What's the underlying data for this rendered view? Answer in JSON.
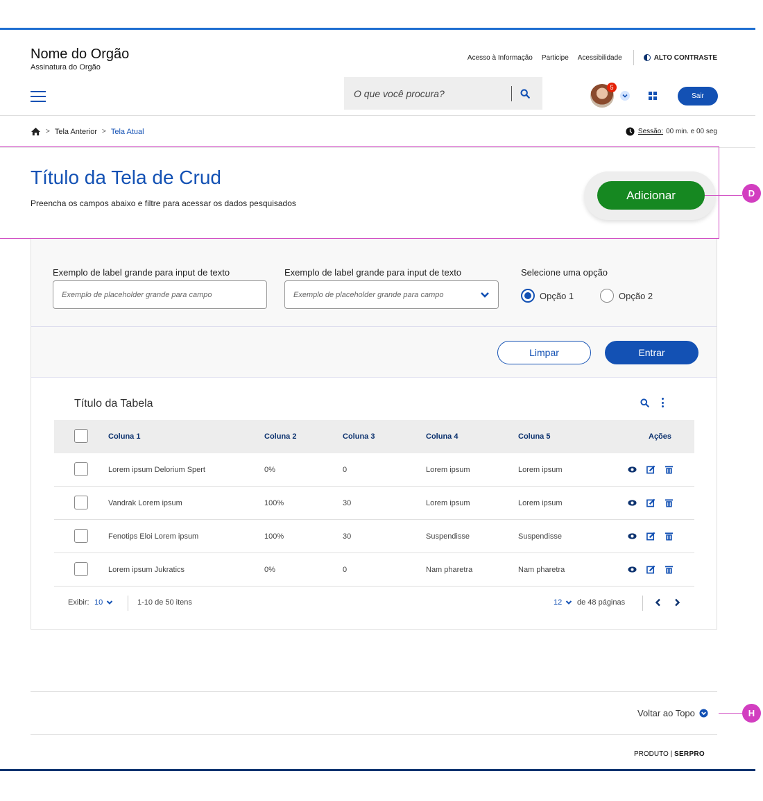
{
  "header": {
    "org_name": "Nome do Orgão",
    "org_subtitle": "Assinatura do Orgão",
    "links": [
      "Acesso à Informação",
      "Participe",
      "Acessibilidade"
    ],
    "contrast_label": "ALTO CONTRASTE",
    "search_placeholder": "O que você procura?",
    "notification_count": "5",
    "logout_label": "Sair"
  },
  "breadcrumb": {
    "previous": "Tela Anterior",
    "current": "Tela Atual"
  },
  "session": {
    "label": "Sessão:",
    "value": "00 min. e 00 seg"
  },
  "page": {
    "title": "Título da Tela de Crud",
    "subtitle": "Preencha os campos abaixo e filtre para acessar os dados pesquisados",
    "add_label": "Adicionar"
  },
  "annotations": {
    "marker_d": "D",
    "marker_h": "H"
  },
  "filters": {
    "text_label": "Exemplo de label grande para input de texto",
    "text_placeholder": "Exemplo de placeholder grande para campo",
    "select_label": "Exemplo de label grande para input de texto",
    "select_placeholder": "Exemplo de placeholder grande para campo",
    "radio_label": "Selecione uma opção",
    "radio_options": [
      "Opção 1",
      "Opção 2"
    ],
    "radio_selected": "Opção 1",
    "clear_label": "Limpar",
    "submit_label": "Entrar"
  },
  "table": {
    "title": "Título da Tabela",
    "columns": [
      "Coluna 1",
      "Coluna 2",
      "Coluna 3",
      "Coluna 4",
      "Coluna 5",
      "Ações"
    ],
    "rows": [
      [
        "Lorem ipsum Delorium Spert",
        "0%",
        "0",
        "Lorem ipsum",
        "Lorem ipsum"
      ],
      [
        "Vandrak Lorem ipsum",
        "100%",
        "30",
        "Lorem ipsum",
        "Lorem ipsum"
      ],
      [
        "Fenotips Eloi Lorem ipsum",
        "100%",
        "30",
        "Suspendisse",
        "Suspendisse"
      ],
      [
        "Lorem ipsum Jukratics",
        "0%",
        "0",
        "Nam pharetra",
        "Nam pharetra"
      ]
    ],
    "pagination": {
      "show_label": "Exibir:",
      "show_value": "10",
      "range_text": "1-10 de 50 itens",
      "current_page": "12",
      "pages_text": "de 48 páginas"
    }
  },
  "footer": {
    "back_to_top": "Voltar ao Topo",
    "brand_prefix": "PRODUTO |",
    "brand_name": "SERPRO"
  },
  "colors": {
    "primary": "#1351b4",
    "success": "#168821",
    "annotation": "#d23ec0",
    "danger": "#e52207"
  }
}
